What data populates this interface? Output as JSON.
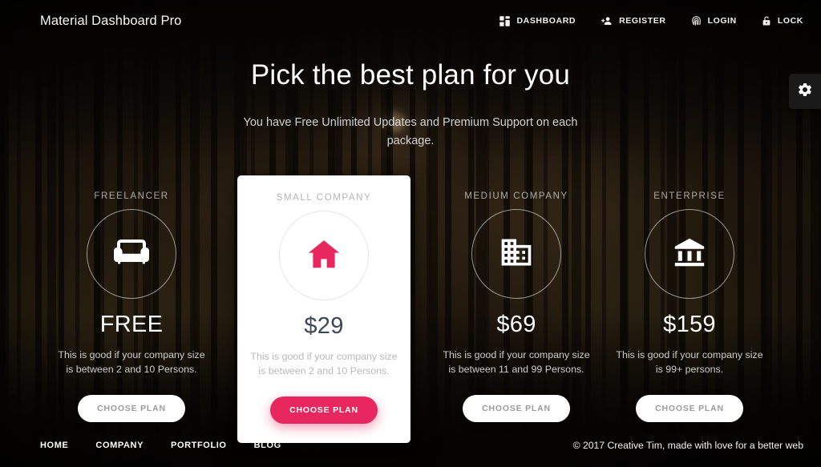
{
  "header": {
    "brand": "Material Dashboard Pro",
    "nav": [
      {
        "label": "DASHBOARD",
        "icon": "dashboard-icon"
      },
      {
        "label": "REGISTER",
        "icon": "person-add-icon"
      },
      {
        "label": "LOGIN",
        "icon": "fingerprint-icon"
      },
      {
        "label": "LOCK",
        "icon": "lock-open-icon"
      }
    ]
  },
  "hero": {
    "title": "Pick the best plan for you",
    "subtitle": "You have Free Unlimited Updates and Premium Support on each package."
  },
  "settings": {
    "icon": "gear-icon",
    "label": "Settings"
  },
  "plans": [
    {
      "name": "FREELANCER",
      "icon": "sofa-icon",
      "price": "FREE",
      "description": "This is good if your company size is between 2 and 10 Persons.",
      "button": "CHOOSE PLAN",
      "featured": false
    },
    {
      "name": "SMALL COMPANY",
      "icon": "home-icon",
      "price": "$29",
      "description": "This is good if your company size is between 2 and 10 Persons.",
      "button": "CHOOSE PLAN",
      "featured": true
    },
    {
      "name": "MEDIUM COMPANY",
      "icon": "domain-icon",
      "price": "$69",
      "description": "This is good if your company size is between 11 and 99 Persons.",
      "button": "CHOOSE PLAN",
      "featured": false
    },
    {
      "name": "ENTERPRISE",
      "icon": "bank-icon",
      "price": "$159",
      "description": "This is good if your company size is 99+ persons.",
      "button": "CHOOSE PLAN",
      "featured": false
    }
  ],
  "footer": {
    "links": [
      "HOME",
      "COMPANY",
      "PORTFOLIO",
      "BLOG"
    ],
    "copyright": "© 2017 Creative Tim, made with love for a better web"
  },
  "colors": {
    "accent_pink": "#e8275e",
    "featured_card_bg": "#ffffff",
    "price_featured": "#3c4858",
    "muted_text": "#b4b4b4"
  }
}
